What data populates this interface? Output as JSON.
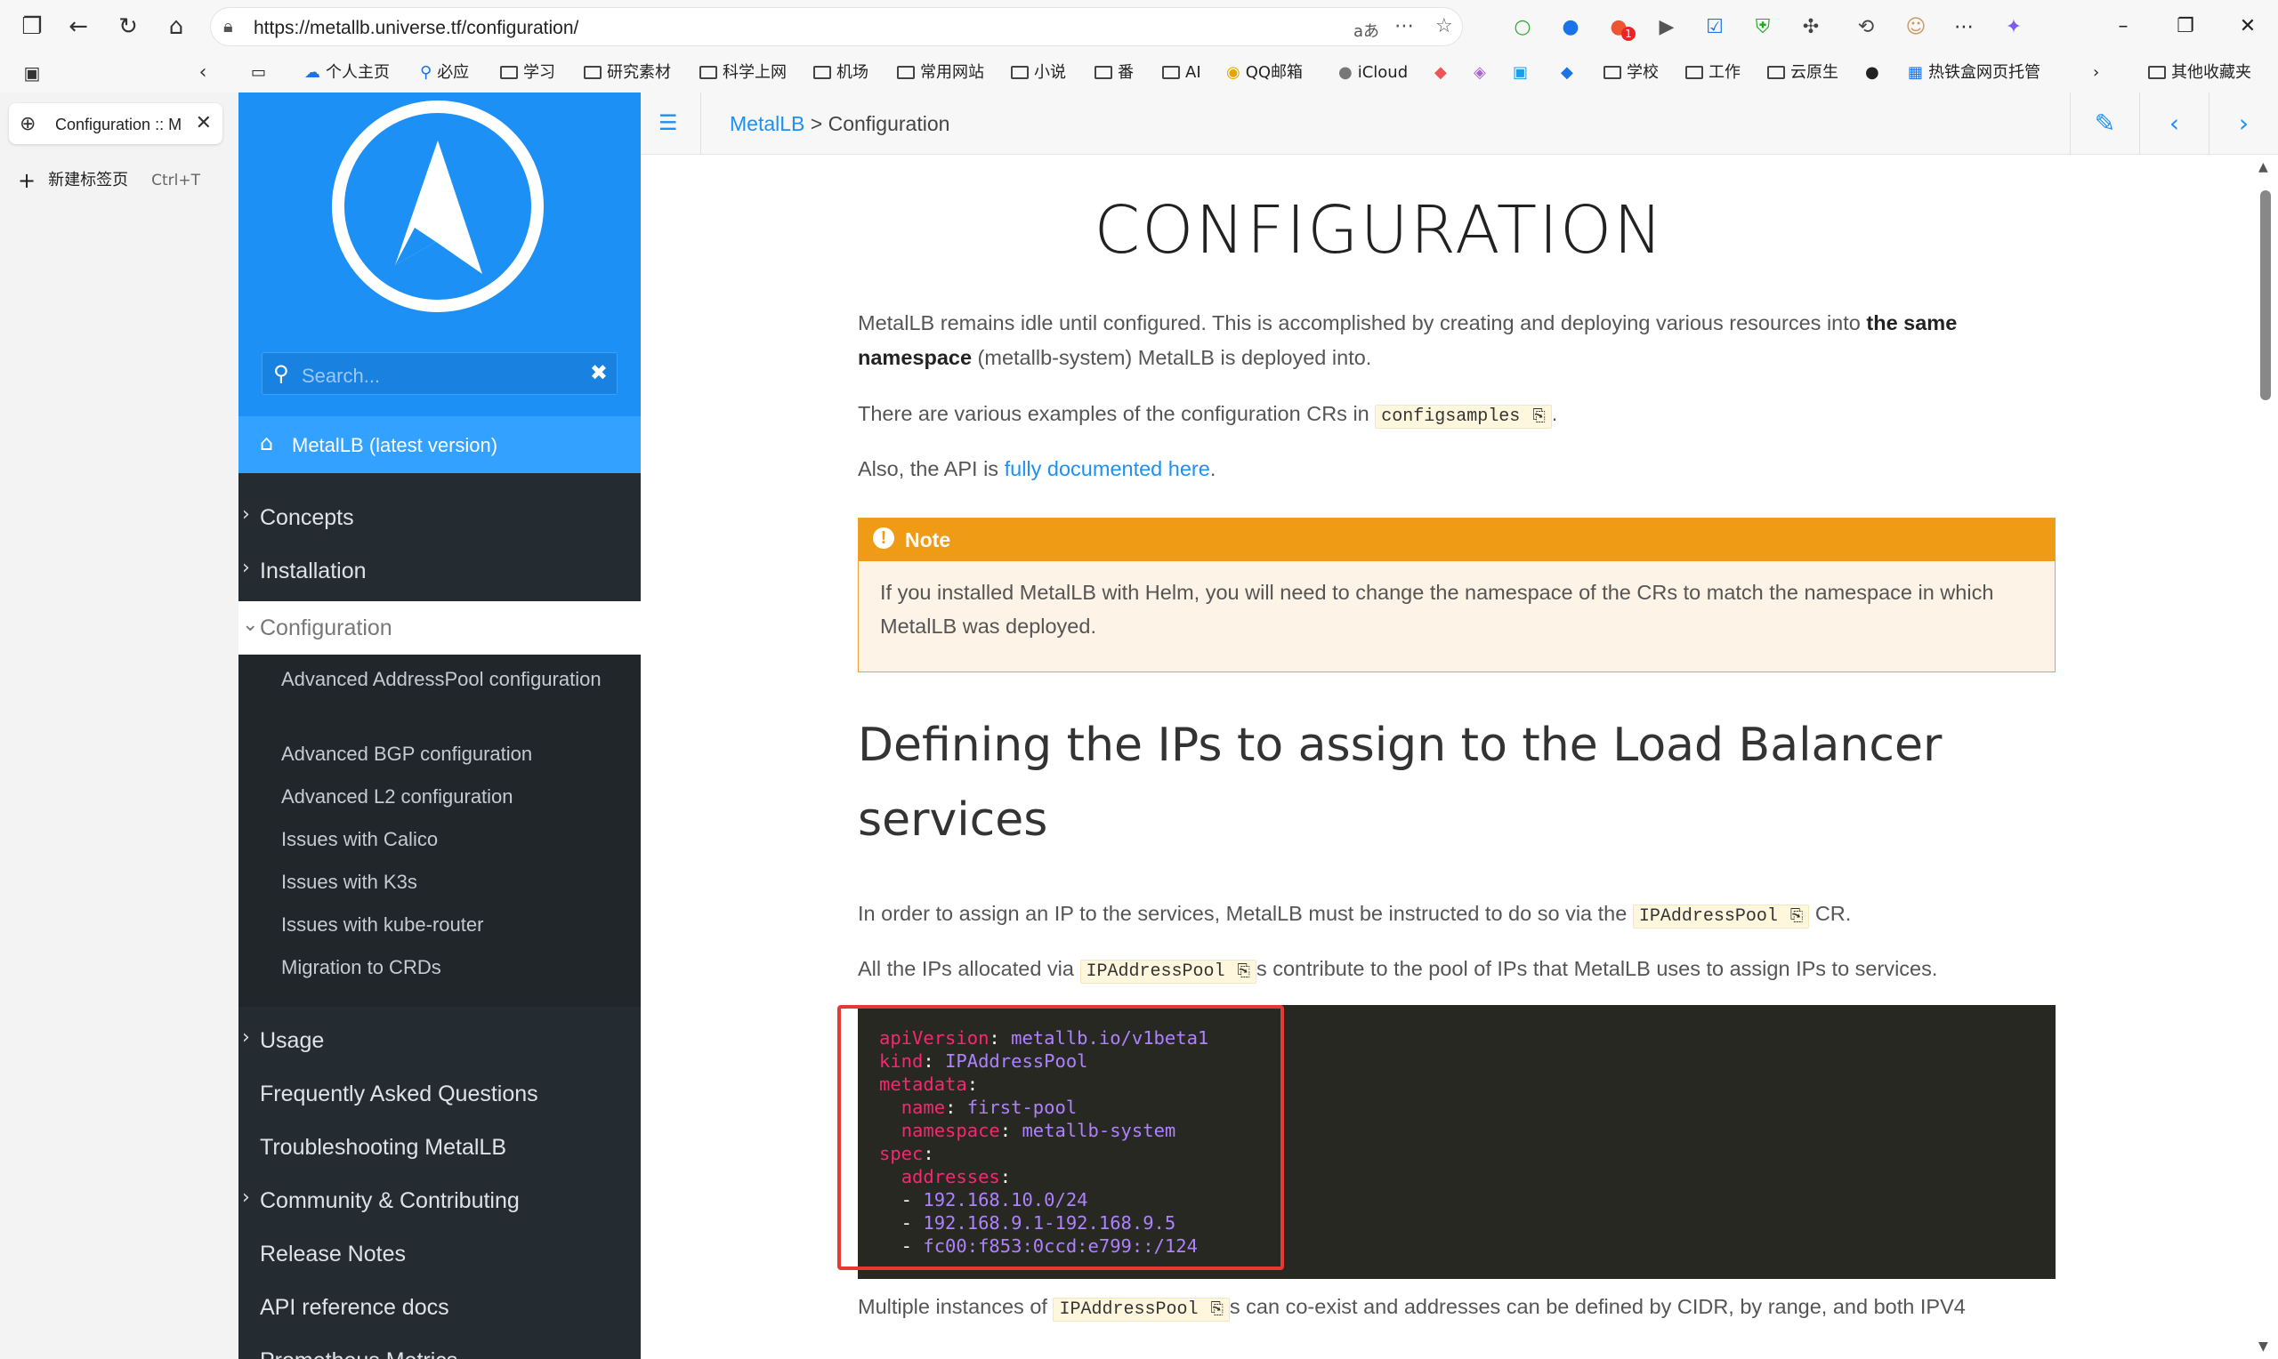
{
  "browser": {
    "url": "https://metallb.universe.tf/configuration/",
    "translate_label": "aあ",
    "tab_title": "Configuration :: M",
    "new_tab_label": "新建标签页",
    "new_tab_shortcut": "Ctrl+T",
    "bookmarks": [
      "个人主页",
      "必应",
      "学习",
      "研究素材",
      "科学上网",
      "机场",
      "常用网站",
      "小说",
      "番",
      "AI",
      "QQ邮箱",
      "iCloud",
      "学校",
      "工作",
      "云原生",
      "热铁盒网页托管",
      "其他收藏夹"
    ],
    "notification_count": "1"
  },
  "sidebar": {
    "search_placeholder": "Search...",
    "home_label": "MetalLB (latest version)",
    "sections": [
      {
        "label": "Concepts"
      },
      {
        "label": "Installation"
      },
      {
        "label": "Configuration"
      },
      {
        "label": "Usage"
      },
      {
        "label": "Frequently Asked Questions"
      },
      {
        "label": "Troubleshooting MetalLB"
      },
      {
        "label": "Community & Contributing"
      },
      {
        "label": "Release Notes"
      },
      {
        "label": "API reference docs"
      },
      {
        "label": "Prometheus Metrics"
      }
    ],
    "config_children": [
      "Advanced AddressPool configuration",
      "Advanced BGP configuration",
      "Advanced L2 configuration",
      "Issues with Calico",
      "Issues with K3s",
      "Issues with kube-router",
      "Migration to CRDs"
    ]
  },
  "breadcrumb": {
    "root": "MetalLB",
    "sep": ">",
    "current": "Configuration"
  },
  "article": {
    "title": "CONFIGURATION",
    "p1_a": "MetalLB remains idle until configured. This is accomplished by creating and deploying various resources into ",
    "p1_b": "the same namespace",
    "p1_c": " (metallb-system) MetalLB is deployed into.",
    "p2_a": "There are various examples of the configuration CRs in ",
    "p2_code": "configsamples",
    "p2_b": ".",
    "p3_a": "Also, the API is ",
    "p3_link": "fully documented here",
    "p3_b": ".",
    "note_title": "Note",
    "note_body": "If you installed MetalLB with Helm, you will need to change the namespace of the CRs to match the namespace in which MetalLB was deployed.",
    "h2": "Defining the IPs to assign to the Load Balancer services",
    "p4_a": "In order to assign an IP to the services, MetalLB must be instructed to do so via the ",
    "p4_code": "IPAddressPool",
    "p4_b": " CR.",
    "p5_a": "All the IPs allocated via ",
    "p5_code": "IPAddressPool",
    "p5_b": "s contribute to the pool of IPs that MetalLB uses to assign IPs to services.",
    "p6_a": "Multiple instances of ",
    "p6_code": "IPAddressPool",
    "p6_b": "s can co-exist and addresses can be defined by CIDR, by range, and both IPV4"
  },
  "code": {
    "apiVersion_k": "apiVersion",
    "apiVersion_v": "metallb.io/v1beta1",
    "kind_k": "kind",
    "kind_v": "IPAddressPool",
    "metadata_k": "metadata",
    "name_k": "name",
    "name_v": "first-pool",
    "namespace_k": "namespace",
    "namespace_v": "metallb-system",
    "spec_k": "spec",
    "addresses_k": "addresses",
    "addr1": "192.168.10.0/24",
    "addr2": "192.168.9.1-192.168.9.5",
    "addr3": "fc00:f853:0ccd:e799::/124"
  },
  "colors": {
    "brand_blue": "#1d90f5",
    "sidebar_dark": "#252c31",
    "note_orange": "#f09b16",
    "code_bg": "#272822",
    "yaml_key": "#f92672",
    "yaml_value": "#ae81ff",
    "highlight_red": "#e53935"
  }
}
